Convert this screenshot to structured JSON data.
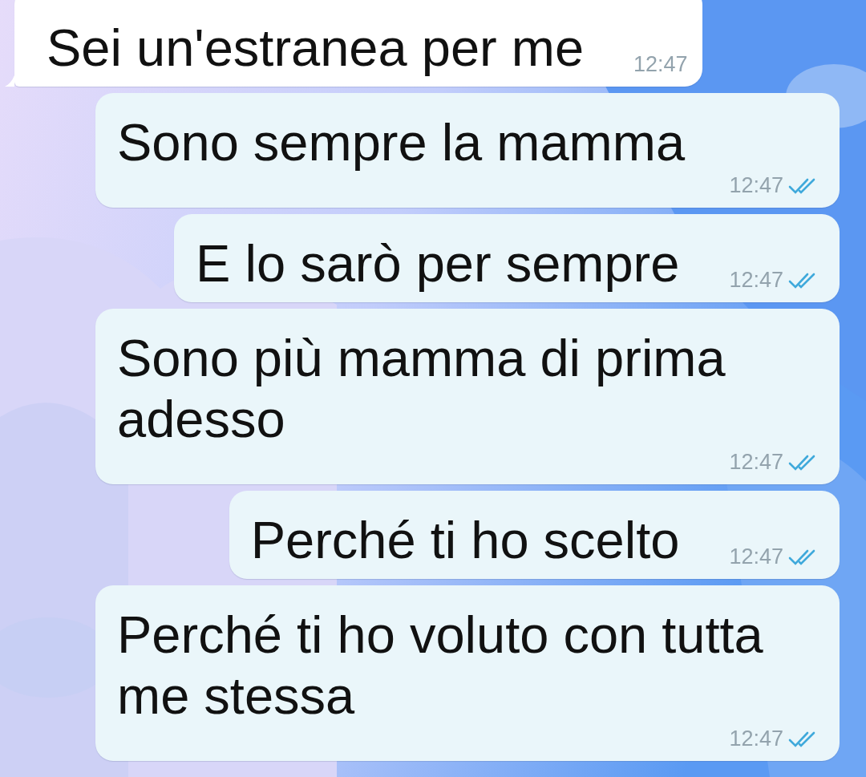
{
  "messages": [
    {
      "outgoing": false,
      "text": "Sei un'estranea per me",
      "time": "12:47"
    },
    {
      "outgoing": true,
      "text": "Sono sempre la mamma",
      "time": "12:47",
      "read": true
    },
    {
      "outgoing": true,
      "text": "E lo sarò per sempre",
      "time": "12:47",
      "read": true
    },
    {
      "outgoing": true,
      "text": "Sono più mamma di prima adesso",
      "time": "12:47",
      "read": true
    },
    {
      "outgoing": true,
      "text": "Perché ti ho scelto",
      "time": "12:47",
      "read": true
    },
    {
      "outgoing": true,
      "text": "Perché ti ho voluto con tutta me stessa",
      "time": "12:47",
      "read": true
    }
  ]
}
